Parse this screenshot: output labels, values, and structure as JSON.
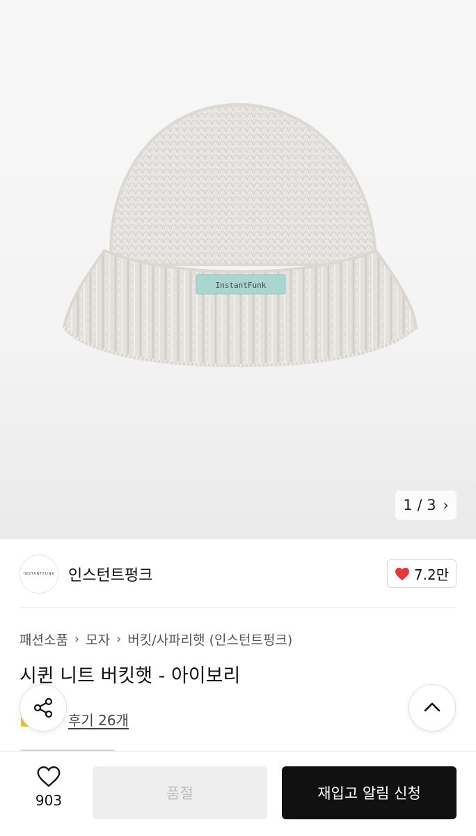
{
  "gallery": {
    "page_current": "1",
    "page_sep": "/",
    "page_total": "3",
    "hat_label": "InstantFunk"
  },
  "brand": {
    "logo_text": "INSTANTFUNK",
    "name": "인스턴트펑크",
    "likes": "7.2만"
  },
  "breadcrumb": [
    "패션소품",
    "모자",
    "버킷/사파리햇 (인스턴트펑크)"
  ],
  "product": {
    "title": "시퀸 니트 버킷햇 - 아이보리",
    "review_link": "후기 26개"
  },
  "bottom_bar": {
    "wish_count": "903",
    "soldout_label": "품절",
    "restock_label": "재입고 알림 신청"
  },
  "colors": {
    "heart": "#e5383b",
    "cta_bg": "#111111",
    "disabled_bg": "#eeeeee"
  }
}
